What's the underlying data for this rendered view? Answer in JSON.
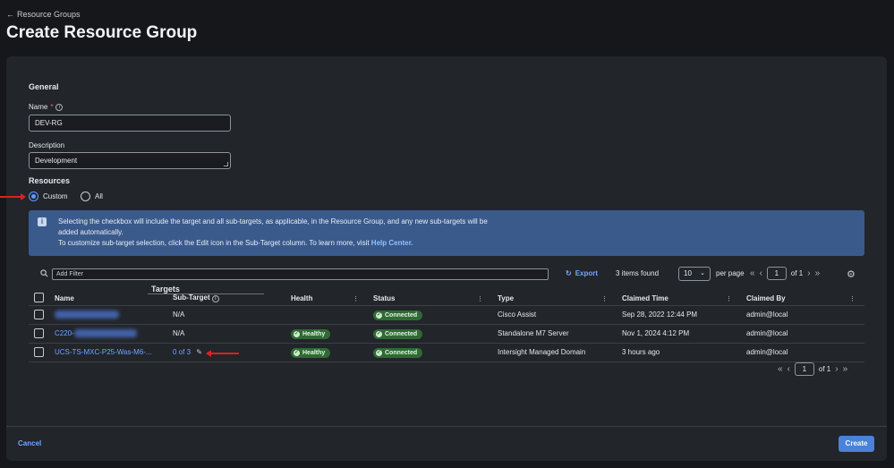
{
  "header": {
    "back_label": "Resource Groups",
    "title": "Create Resource Group"
  },
  "general": {
    "section_title": "General",
    "name_label": "Name",
    "name_required_mark": "*",
    "name_value": "DEV-RG",
    "description_label": "Description",
    "description_value": "Development"
  },
  "resources": {
    "section_title": "Resources",
    "options": [
      {
        "label": "Custom",
        "checked": true
      },
      {
        "label": "All",
        "checked": false
      }
    ]
  },
  "banner": {
    "line1": "Selecting the checkbox will include the target and all sub-targets, as applicable, in the Resource Group, and any new sub-targets will be",
    "line2": "added automatically.",
    "line3_prefix": "To customize sub-target selection, click the Edit icon in the Sub-Target column. To learn more, visit ",
    "line3_link": "Help Center."
  },
  "toolbar": {
    "filter_placeholder": "Add Filter",
    "export_label": "Export",
    "items_found": "3 items found",
    "per_page_value": "10",
    "per_page_label": "per page",
    "page_value": "1",
    "page_of": "of 1"
  },
  "table": {
    "group_header": "Targets",
    "columns": [
      "Name",
      "Sub-Target",
      "Health",
      "Status",
      "Type",
      "Claimed Time",
      "Claimed By"
    ],
    "rows": [
      {
        "name": "",
        "sub_target": "N/A",
        "health": "",
        "status": "Connected",
        "type": "Cisco Assist",
        "claimed_time": "Sep 28, 2022 12:44 PM",
        "claimed_by": "admin@local"
      },
      {
        "name": "C220-",
        "sub_target": "N/A",
        "health": "Healthy",
        "status": "Connected",
        "type": "Standalone M7 Server",
        "claimed_time": "Nov 1, 2024 4:12 PM",
        "claimed_by": "admin@local"
      },
      {
        "name": "UCS-TS-MXC-P25-Was-M6-...",
        "sub_target": "0 of 3",
        "health": "Healthy",
        "status": "Connected",
        "type": "Intersight Managed Domain",
        "claimed_time": "3 hours ago",
        "claimed_by": "admin@local"
      }
    ]
  },
  "bottom_pager": {
    "page_value": "1",
    "page_of": "of 1"
  },
  "footer": {
    "cancel_label": "Cancel",
    "create_label": "Create"
  },
  "colors": {
    "accent": "#6ea8ff",
    "primary_button": "#4a82d9",
    "banner_bg": "#3a5a8c",
    "status_green": "#2f6a34",
    "annotation_red": "#e0201f"
  }
}
